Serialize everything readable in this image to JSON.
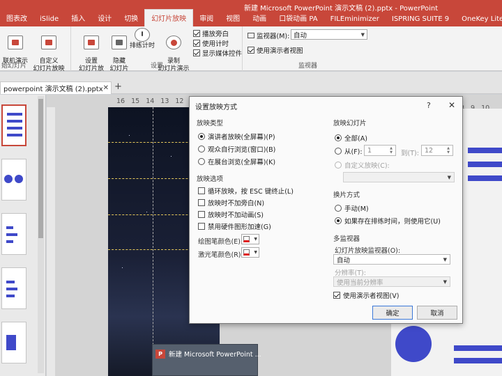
{
  "app": {
    "window_title": "新建 Microsoft PowerPoint 演示文稿 (2).pptx - PowerPoint"
  },
  "ribbon_tabs": [
    "图表改",
    "iSlide",
    "插入",
    "设计",
    "切换",
    "幻灯片放映",
    "审阅",
    "视图",
    "动画",
    "口袋动画 PA",
    "FILEminimizer",
    "ISPRING SUITE 9",
    "OneKey Lite"
  ],
  "ribbon": {
    "start_group": {
      "btn1_label": "联机演示",
      "btn2_label": "自定义\n幻灯片放映",
      "group_label": "始幻灯片"
    },
    "settings_group": {
      "setup_label": "设置\n幻灯片放映",
      "hide_label": "隐藏\n幻灯片",
      "rehearse_label": "排练计时",
      "record_label": "录制\n幻灯片演示",
      "checkboxes": [
        "播放旁白",
        "使用计时",
        "显示媒体控件"
      ],
      "group_label": "设置"
    },
    "monitor_group": {
      "monitor_label": "监视器(M):",
      "monitor_value": "自动",
      "presenter_view_label": "使用演示者视图",
      "group_label": "监视器"
    }
  },
  "doc_tab": {
    "label": "powerpoint 演示文稿 (2).pptx",
    "close": "✕",
    "new_tab": "+"
  },
  "ruler": {
    "left_ticks": [
      "16",
      "15",
      "14",
      "13",
      "12"
    ],
    "right_ticks": [
      "8",
      "9",
      "10"
    ]
  },
  "preview": {
    "icon_text": "P",
    "title": "新建 Microsoft PowerPoint ..."
  },
  "dialog": {
    "title": "设置放映方式",
    "help": "?",
    "close": "✕",
    "show_type": {
      "label": "放映类型",
      "options": [
        "演讲者放映(全屏幕)(P)",
        "观众自行浏览(窗口)(B)",
        "在展台浏览(全屏幕)(K)"
      ],
      "selected_index": 0
    },
    "show_options": {
      "label": "放映选项",
      "checkboxes": [
        "循环放映，按 ESC 键终止(L)",
        "放映时不加旁白(N)",
        "放映时不加动画(S)",
        "禁用硬件图形加速(G)"
      ],
      "pen_color_label": "绘图笔颜色(E):",
      "laser_color_label": "激光笔颜色(R):",
      "pen_color": "#e01a1a",
      "laser_color": "#e01a1a"
    },
    "slides": {
      "label": "放映幻灯片",
      "all_label": "全部(A)",
      "from_label": "从(F):",
      "from_value": "1",
      "to_label": "到(T):",
      "to_value": "12",
      "custom_label": "自定义放映(C):"
    },
    "advance": {
      "label": "换片方式",
      "manual_label": "手动(M)",
      "timings_label": "如果存在排练时间，则使用它(U)",
      "selected_index": 1
    },
    "multi_monitor": {
      "label": "多监视器",
      "monitor_label": "幻灯片放映监视器(O):",
      "monitor_value": "自动",
      "resolution_label": "分辨率(T):",
      "resolution_value": "使用当前分辨率",
      "presenter_view_label": "使用演示者视图(V)"
    },
    "ok_label": "确定",
    "cancel_label": "取消"
  },
  "colors": {
    "accent": "#c8473a",
    "slide_blue": "#3f49c9"
  }
}
